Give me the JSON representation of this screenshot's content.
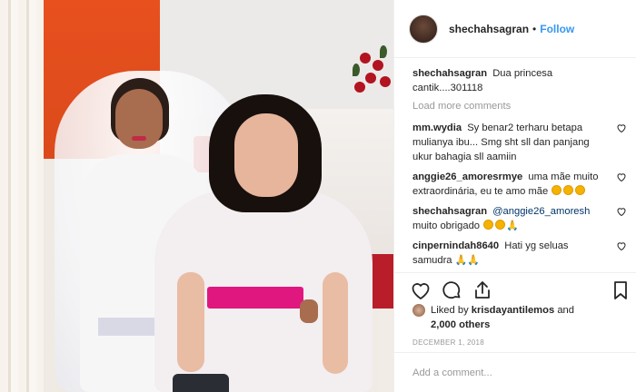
{
  "post": {
    "username": "shechahsagran",
    "follow_label": "Follow",
    "separator": "•"
  },
  "caption": {
    "username": "shechahsagran",
    "text": "Dua princesa cantik....301118"
  },
  "load_more_label": "Load more comments",
  "comments": [
    {
      "username": "mm.wydia",
      "text": "Sy benar2 terharu betapa mulianya ibu... Smg sht sll dan panjang ukur bahagia sll aamiin",
      "mention": "",
      "after": ""
    },
    {
      "username": "anggie26_amoresrmye",
      "text": "uma mãe muito extraordinária, eu te amo mãe",
      "mention": "",
      "after": ""
    },
    {
      "username": "shechahsagran",
      "text": "",
      "mention": "@anggie26_amoresh",
      "after": "muito obrigado"
    },
    {
      "username": "cinpernindah8640",
      "text": "Hati yg seluas samudra",
      "mention": "",
      "after": ""
    }
  ],
  "icons": {
    "like": "heart-icon",
    "comment": "comment-icon",
    "share": "share-icon",
    "save": "bookmark-icon"
  },
  "likes": {
    "prefix": "Liked by",
    "user": "krisdayantilemos",
    "and": "and",
    "others": "2,000 others"
  },
  "date": "DECEMBER 1, 2018",
  "add_comment_placeholder": "Add a comment...",
  "colors": {
    "link_blue": "#3897f0",
    "text_dark": "#262626",
    "text_muted": "#999999"
  }
}
